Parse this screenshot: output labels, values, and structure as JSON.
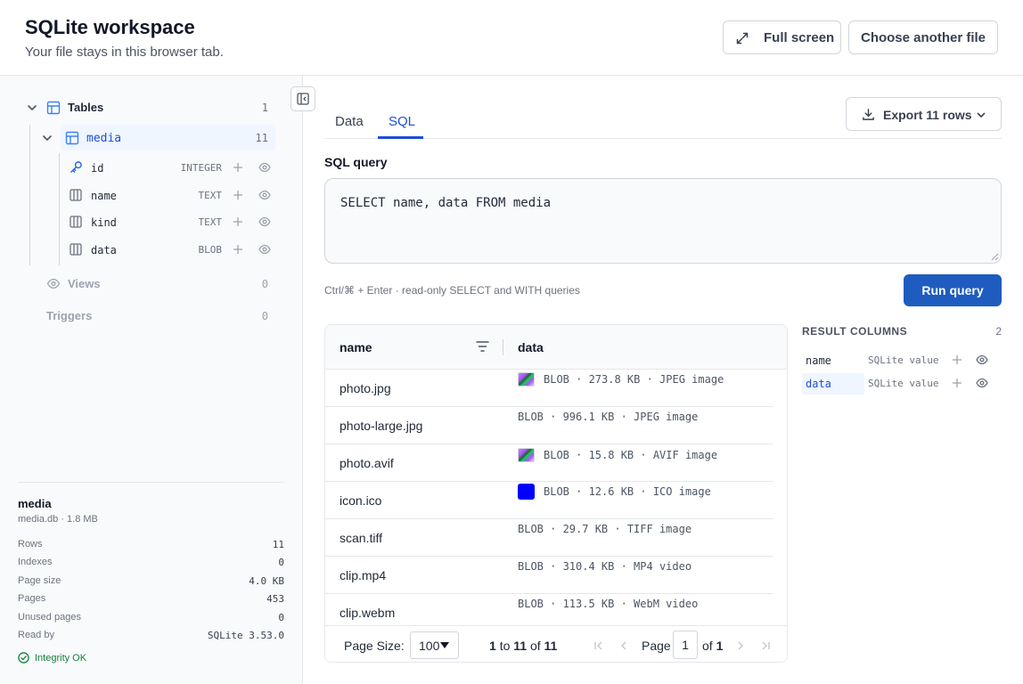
{
  "header": {
    "title": "SQLite workspace",
    "subtitle": "Your file stays in this browser tab.",
    "fullscreen_label": "Full screen",
    "choose_label": "Choose another file"
  },
  "sidebar": {
    "tables_label": "Tables",
    "tables_count": "1",
    "table": {
      "name": "media",
      "count": "11"
    },
    "columns": [
      {
        "name": "id",
        "type": "INTEGER",
        "icon": "key-icon"
      },
      {
        "name": "name",
        "type": "TEXT",
        "icon": "column-icon"
      },
      {
        "name": "kind",
        "type": "TEXT",
        "icon": "column-icon"
      },
      {
        "name": "data",
        "type": "BLOB",
        "icon": "column-icon"
      }
    ],
    "views_label": "Views",
    "views_count": "0",
    "triggers_label": "Triggers",
    "triggers_count": "0"
  },
  "info": {
    "title": "media",
    "subtitle": "media.db · 1.8 MB",
    "stats": [
      {
        "label": "Rows",
        "value": "11"
      },
      {
        "label": "Indexes",
        "value": "0"
      },
      {
        "label": "Page size",
        "value": "4.0 KB"
      },
      {
        "label": "Pages",
        "value": "453"
      },
      {
        "label": "Unused pages",
        "value": "0"
      },
      {
        "label": "Read by",
        "value": "SQLite 3.53.0"
      }
    ],
    "integrity": "Integrity OK"
  },
  "main": {
    "tabs": [
      {
        "label": "Data"
      },
      {
        "label": "SQL"
      }
    ],
    "export_label": "Export 11 rows",
    "sql_label": "SQL query",
    "sql_text": "SELECT name, data FROM media",
    "hint": "Ctrl/⌘ + Enter · read-only SELECT and WITH queries",
    "run_label": "Run query"
  },
  "grid": {
    "columns": [
      "name",
      "data"
    ],
    "rows": [
      {
        "name": "photo.jpg",
        "data": "BLOB · 273.8 KB · JPEG image",
        "thumb": "image"
      },
      {
        "name": "photo-large.jpg",
        "data": "BLOB · 996.1 KB · JPEG image",
        "thumb": ""
      },
      {
        "name": "photo.avif",
        "data": "BLOB · 15.8 KB · AVIF image",
        "thumb": "image"
      },
      {
        "name": "icon.ico",
        "data": "BLOB · 12.6 KB · ICO image",
        "thumb": "blue"
      },
      {
        "name": "scan.tiff",
        "data": "BLOB · 29.7 KB · TIFF image",
        "thumb": ""
      },
      {
        "name": "clip.mp4",
        "data": "BLOB · 310.4 KB · MP4 video",
        "thumb": ""
      },
      {
        "name": "clip.webm",
        "data": "BLOB · 113.5 KB · WebM video",
        "thumb": ""
      }
    ],
    "page_size_label": "Page Size:",
    "page_size_value": "100",
    "range_from": "1",
    "range_to_word": "to",
    "range_to": "11",
    "range_of_word": "of",
    "range_total": "11",
    "page_label": "Page",
    "page_value": "1",
    "page_of_word": "of",
    "page_total": "1"
  },
  "result_columns": {
    "title": "RESULT COLUMNS",
    "count": "2",
    "items": [
      {
        "name": "name",
        "type": "SQLite value"
      },
      {
        "name": "data",
        "type": "SQLite value"
      }
    ]
  },
  "colors": {
    "accent": "#1d4ed8",
    "run_button": "#1e5cbf",
    "ok": "#15803d"
  }
}
